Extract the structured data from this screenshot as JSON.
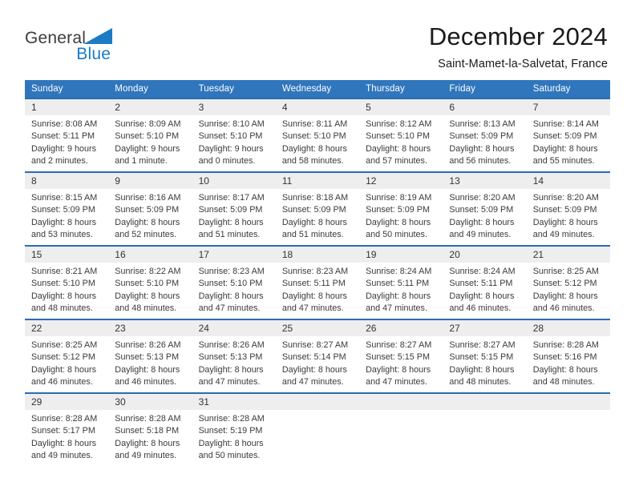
{
  "brand": {
    "name_part1": "General",
    "name_part2": "Blue",
    "logo_icon": "blue-triangle-logo",
    "accent_color": "#1b7bc4"
  },
  "header": {
    "title": "December 2024",
    "subtitle": "Saint-Mamet-la-Salvetat, France"
  },
  "theme": {
    "header_blue": "#3076bd",
    "cell_top_border": "#2b6cb0",
    "daynum_band": "#eeeeee"
  },
  "weekday_headers": [
    "Sunday",
    "Monday",
    "Tuesday",
    "Wednesday",
    "Thursday",
    "Friday",
    "Saturday"
  ],
  "weeks": [
    [
      {
        "day": "1",
        "sunrise": "Sunrise: 8:08 AM",
        "sunset": "Sunset: 5:11 PM",
        "daylight_line1": "Daylight: 9 hours",
        "daylight_line2": "and 2 minutes."
      },
      {
        "day": "2",
        "sunrise": "Sunrise: 8:09 AM",
        "sunset": "Sunset: 5:10 PM",
        "daylight_line1": "Daylight: 9 hours",
        "daylight_line2": "and 1 minute."
      },
      {
        "day": "3",
        "sunrise": "Sunrise: 8:10 AM",
        "sunset": "Sunset: 5:10 PM",
        "daylight_line1": "Daylight: 9 hours",
        "daylight_line2": "and 0 minutes."
      },
      {
        "day": "4",
        "sunrise": "Sunrise: 8:11 AM",
        "sunset": "Sunset: 5:10 PM",
        "daylight_line1": "Daylight: 8 hours",
        "daylight_line2": "and 58 minutes."
      },
      {
        "day": "5",
        "sunrise": "Sunrise: 8:12 AM",
        "sunset": "Sunset: 5:10 PM",
        "daylight_line1": "Daylight: 8 hours",
        "daylight_line2": "and 57 minutes."
      },
      {
        "day": "6",
        "sunrise": "Sunrise: 8:13 AM",
        "sunset": "Sunset: 5:09 PM",
        "daylight_line1": "Daylight: 8 hours",
        "daylight_line2": "and 56 minutes."
      },
      {
        "day": "7",
        "sunrise": "Sunrise: 8:14 AM",
        "sunset": "Sunset: 5:09 PM",
        "daylight_line1": "Daylight: 8 hours",
        "daylight_line2": "and 55 minutes."
      }
    ],
    [
      {
        "day": "8",
        "sunrise": "Sunrise: 8:15 AM",
        "sunset": "Sunset: 5:09 PM",
        "daylight_line1": "Daylight: 8 hours",
        "daylight_line2": "and 53 minutes."
      },
      {
        "day": "9",
        "sunrise": "Sunrise: 8:16 AM",
        "sunset": "Sunset: 5:09 PM",
        "daylight_line1": "Daylight: 8 hours",
        "daylight_line2": "and 52 minutes."
      },
      {
        "day": "10",
        "sunrise": "Sunrise: 8:17 AM",
        "sunset": "Sunset: 5:09 PM",
        "daylight_line1": "Daylight: 8 hours",
        "daylight_line2": "and 51 minutes."
      },
      {
        "day": "11",
        "sunrise": "Sunrise: 8:18 AM",
        "sunset": "Sunset: 5:09 PM",
        "daylight_line1": "Daylight: 8 hours",
        "daylight_line2": "and 51 minutes."
      },
      {
        "day": "12",
        "sunrise": "Sunrise: 8:19 AM",
        "sunset": "Sunset: 5:09 PM",
        "daylight_line1": "Daylight: 8 hours",
        "daylight_line2": "and 50 minutes."
      },
      {
        "day": "13",
        "sunrise": "Sunrise: 8:20 AM",
        "sunset": "Sunset: 5:09 PM",
        "daylight_line1": "Daylight: 8 hours",
        "daylight_line2": "and 49 minutes."
      },
      {
        "day": "14",
        "sunrise": "Sunrise: 8:20 AM",
        "sunset": "Sunset: 5:09 PM",
        "daylight_line1": "Daylight: 8 hours",
        "daylight_line2": "and 49 minutes."
      }
    ],
    [
      {
        "day": "15",
        "sunrise": "Sunrise: 8:21 AM",
        "sunset": "Sunset: 5:10 PM",
        "daylight_line1": "Daylight: 8 hours",
        "daylight_line2": "and 48 minutes."
      },
      {
        "day": "16",
        "sunrise": "Sunrise: 8:22 AM",
        "sunset": "Sunset: 5:10 PM",
        "daylight_line1": "Daylight: 8 hours",
        "daylight_line2": "and 48 minutes."
      },
      {
        "day": "17",
        "sunrise": "Sunrise: 8:23 AM",
        "sunset": "Sunset: 5:10 PM",
        "daylight_line1": "Daylight: 8 hours",
        "daylight_line2": "and 47 minutes."
      },
      {
        "day": "18",
        "sunrise": "Sunrise: 8:23 AM",
        "sunset": "Sunset: 5:11 PM",
        "daylight_line1": "Daylight: 8 hours",
        "daylight_line2": "and 47 minutes."
      },
      {
        "day": "19",
        "sunrise": "Sunrise: 8:24 AM",
        "sunset": "Sunset: 5:11 PM",
        "daylight_line1": "Daylight: 8 hours",
        "daylight_line2": "and 47 minutes."
      },
      {
        "day": "20",
        "sunrise": "Sunrise: 8:24 AM",
        "sunset": "Sunset: 5:11 PM",
        "daylight_line1": "Daylight: 8 hours",
        "daylight_line2": "and 46 minutes."
      },
      {
        "day": "21",
        "sunrise": "Sunrise: 8:25 AM",
        "sunset": "Sunset: 5:12 PM",
        "daylight_line1": "Daylight: 8 hours",
        "daylight_line2": "and 46 minutes."
      }
    ],
    [
      {
        "day": "22",
        "sunrise": "Sunrise: 8:25 AM",
        "sunset": "Sunset: 5:12 PM",
        "daylight_line1": "Daylight: 8 hours",
        "daylight_line2": "and 46 minutes."
      },
      {
        "day": "23",
        "sunrise": "Sunrise: 8:26 AM",
        "sunset": "Sunset: 5:13 PM",
        "daylight_line1": "Daylight: 8 hours",
        "daylight_line2": "and 46 minutes."
      },
      {
        "day": "24",
        "sunrise": "Sunrise: 8:26 AM",
        "sunset": "Sunset: 5:13 PM",
        "daylight_line1": "Daylight: 8 hours",
        "daylight_line2": "and 47 minutes."
      },
      {
        "day": "25",
        "sunrise": "Sunrise: 8:27 AM",
        "sunset": "Sunset: 5:14 PM",
        "daylight_line1": "Daylight: 8 hours",
        "daylight_line2": "and 47 minutes."
      },
      {
        "day": "26",
        "sunrise": "Sunrise: 8:27 AM",
        "sunset": "Sunset: 5:15 PM",
        "daylight_line1": "Daylight: 8 hours",
        "daylight_line2": "and 47 minutes."
      },
      {
        "day": "27",
        "sunrise": "Sunrise: 8:27 AM",
        "sunset": "Sunset: 5:15 PM",
        "daylight_line1": "Daylight: 8 hours",
        "daylight_line2": "and 48 minutes."
      },
      {
        "day": "28",
        "sunrise": "Sunrise: 8:28 AM",
        "sunset": "Sunset: 5:16 PM",
        "daylight_line1": "Daylight: 8 hours",
        "daylight_line2": "and 48 minutes."
      }
    ],
    [
      {
        "day": "29",
        "sunrise": "Sunrise: 8:28 AM",
        "sunset": "Sunset: 5:17 PM",
        "daylight_line1": "Daylight: 8 hours",
        "daylight_line2": "and 49 minutes."
      },
      {
        "day": "30",
        "sunrise": "Sunrise: 8:28 AM",
        "sunset": "Sunset: 5:18 PM",
        "daylight_line1": "Daylight: 8 hours",
        "daylight_line2": "and 49 minutes."
      },
      {
        "day": "31",
        "sunrise": "Sunrise: 8:28 AM",
        "sunset": "Sunset: 5:19 PM",
        "daylight_line1": "Daylight: 8 hours",
        "daylight_line2": "and 50 minutes."
      },
      {
        "day": "",
        "sunrise": "",
        "sunset": "",
        "daylight_line1": "",
        "daylight_line2": ""
      },
      {
        "day": "",
        "sunrise": "",
        "sunset": "",
        "daylight_line1": "",
        "daylight_line2": ""
      },
      {
        "day": "",
        "sunrise": "",
        "sunset": "",
        "daylight_line1": "",
        "daylight_line2": ""
      },
      {
        "day": "",
        "sunrise": "",
        "sunset": "",
        "daylight_line1": "",
        "daylight_line2": ""
      }
    ]
  ]
}
